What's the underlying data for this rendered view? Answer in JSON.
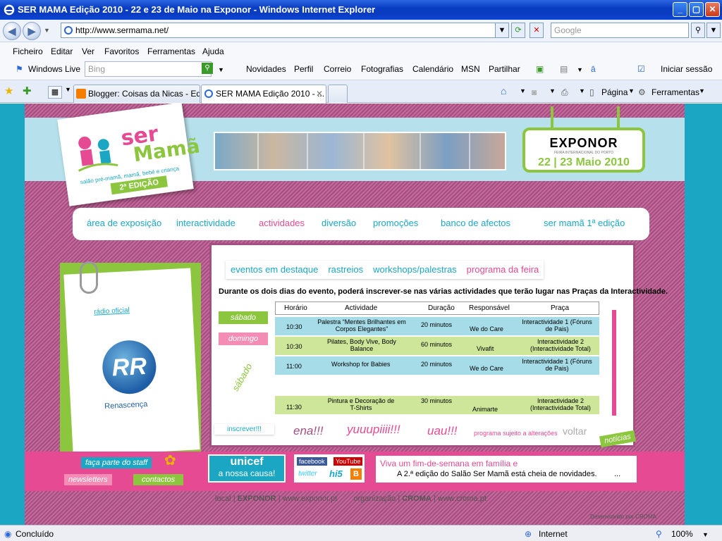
{
  "window": {
    "title": "SER MAMA Edição 2010 - 22 e 23 de Maio na Exponor - Windows Internet Explorer",
    "minimize": "_",
    "maximize": "▢",
    "close": "✕",
    "back": "◀",
    "forward": "▶"
  },
  "address": {
    "url": "http://www.sermama.net/",
    "search_placeholder": "Google"
  },
  "menu": [
    "Ficheiro",
    "Editar",
    "Ver",
    "Favoritos",
    "Ferramentas",
    "Ajuda"
  ],
  "live_bar": {
    "brand": "Windows Live",
    "search_placeholder": "Bing",
    "links": [
      "Novidades",
      "Perfil",
      "Correio",
      "Fotografias",
      "Calendário",
      "MSN",
      "Partilhar"
    ],
    "signin": "Iniciar sessão"
  },
  "tabs": [
    {
      "label": "Blogger: Coisas da Nicas - Ed..."
    },
    {
      "label": "SER MAMA Edição 2010 - ..."
    }
  ],
  "tools": {
    "page": "Página",
    "tools": "Ferramentas"
  },
  "site": {
    "logo": {
      "ser": "ser",
      "mama": "Mamã",
      "tagline": "salão pré-mamã, mamã, bebé e criança",
      "edition": "2ª EDIÇÃO"
    },
    "exponor": {
      "name": "EXPONOR",
      "sub": "FEIRA INTERNACIONAL DO PORTO",
      "dates": "22 | 23 Maio 2010"
    },
    "nav": [
      "área de exposição",
      "interactividade",
      "actividades",
      "diversão",
      "promoções",
      "banco de afectos",
      "ser mamã 1ª edição"
    ],
    "subnav": [
      "eventos em destaque",
      "rastreios",
      "workshops/palestras",
      "programa da feira"
    ],
    "intro": "Durante os dois dias do evento, poderá inscrever-se nas várias actividades que terão lugar nas Praças da Interactividade.",
    "days": {
      "sat": "sábado",
      "sun": "domingo",
      "vertical": "sábado"
    },
    "table": {
      "headers": [
        "Horário",
        "Actividade",
        "Duração",
        "Responsável",
        "Praça"
      ],
      "rows": [
        {
          "time": "10:30",
          "activity": "Palestra “Mentes Brilhantes em Corpos Elegantes”",
          "duration": "20 minutos",
          "resp": "We do Care",
          "praca": "Interactividade 1 (Fóruns de Pais)"
        },
        {
          "time": "10:30",
          "activity": "Pilates, Body Vive, Body Balance",
          "duration": "60 minutos",
          "resp": "Vivafit",
          "praca": "Interactividade 2 (Interactividade Total)"
        },
        {
          "time": "11:00",
          "activity": "Workshop for Babies",
          "duration": "20 minutos",
          "resp": "We do Care",
          "praca": "Interactividade 1 (Fóruns de Pais)"
        },
        {
          "time": "11:30",
          "activity": "Pintura e Decoração de T-Shirts",
          "duration": "30 minutos",
          "resp": "Animarte",
          "praca": "Interactividade 2 (Interactividade Total)"
        }
      ]
    },
    "inscrever": "inscrever!!!",
    "ena": "ena!!!",
    "yuupi": "yuuupiiii!!!",
    "uau": "uau!!!",
    "sujeito": "programa sujeito a alterações",
    "voltar": "voltar",
    "noticias": "notícias",
    "radio": "rádio oficial",
    "renascenca": "Renascença",
    "staff": "faça parte do staff",
    "newsletters": "newsletters",
    "contactos": "contactos",
    "unicef": "unicef",
    "unicef_cause": "a nossa causa!",
    "social": [
      "facebook",
      "YouTube",
      "twitter",
      "hi5"
    ],
    "viva_line1": "Viva um fim-de-semana em família e",
    "viva_line2": "A 2.ª edição do Salão Ser Mamã está cheia de novidades.",
    "footer": [
      "local",
      "EXPONOR",
      "www.exponor.pt",
      "organização",
      "CROMA",
      "www.croma.pt"
    ],
    "developed": "Desenvolvido por CROMA"
  },
  "status": {
    "text": "Concluído",
    "zone": "Internet",
    "zoom": "100%"
  }
}
